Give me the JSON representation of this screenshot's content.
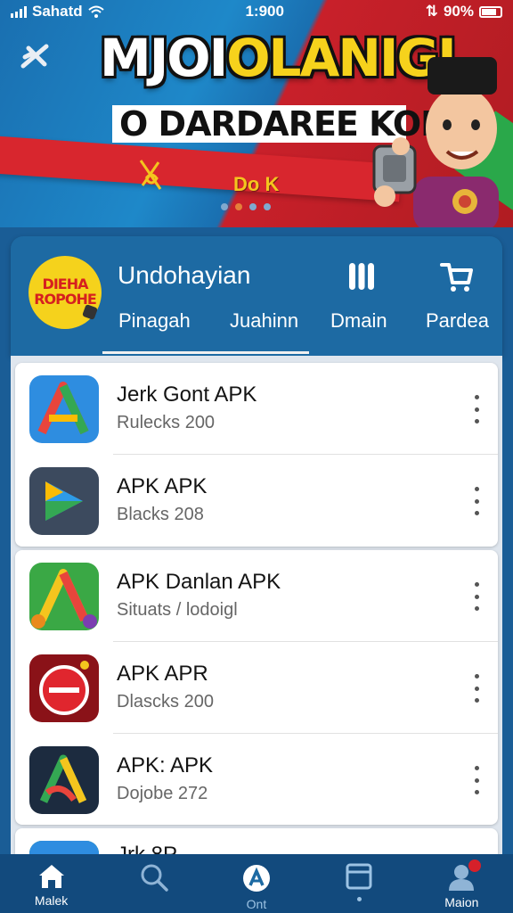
{
  "status_bar": {
    "carrier": "Sahatd",
    "time": "1:900",
    "battery": "90%"
  },
  "banner": {
    "headline_part1": "MJOI",
    "headline_part2": "OLANIGI",
    "subheadline": "O  DARDAREE KOMA",
    "tag": "Do K",
    "page_dots": 4,
    "active_dot": 1
  },
  "profile": {
    "logo_line1": "DIEHA",
    "logo_line2": "ROPOHE",
    "name": "Undohayian",
    "tabs": [
      {
        "label": "Pinagah"
      },
      {
        "label": "Juahinn"
      },
      {
        "label": "Dmain"
      },
      {
        "label": "Pardea"
      }
    ],
    "active_tab": 0
  },
  "apps": [
    {
      "title": "Jerk Gont APK",
      "subtitle": "Rulecks 200",
      "icon": "colorful-a-logo-icon",
      "colors": [
        "#2e8de0",
        "#1a5fc0"
      ]
    },
    {
      "title": "APK APK",
      "subtitle": "Blacks 208",
      "icon": "blue-play-logo-icon",
      "colors": [
        "#3c4a5e",
        "#253243"
      ]
    },
    {
      "title": "APK Danlan APK",
      "subtitle": "Situats / lodoigl",
      "icon": "green-a-flower-logo-icon",
      "colors": [
        "#3aa845",
        "#2b8a38"
      ]
    },
    {
      "title": "APK APR",
      "subtitle": "Dlascks 200",
      "icon": "red-circle-logo-icon",
      "colors": [
        "#8a1218",
        "#5c0b10"
      ]
    },
    {
      "title": "APK: APK",
      "subtitle": "Dojobe 272",
      "icon": "dark-a-logo-icon",
      "colors": [
        "#1c2b3f",
        "#0f1a29"
      ]
    },
    {
      "title": "Jrk 8P",
      "subtitle": "",
      "icon": "partial-app-icon",
      "colors": [
        "#2e8de0",
        "#3aa845"
      ]
    }
  ],
  "bottom_nav": [
    {
      "label": "Malek",
      "icon": "home-icon",
      "active": true
    },
    {
      "label": "",
      "icon": "search-icon"
    },
    {
      "label": "Ont",
      "icon": "center-logo-icon"
    },
    {
      "label": "",
      "icon": "window-icon"
    },
    {
      "label": "Maion",
      "icon": "profile-icon",
      "badge": true
    }
  ]
}
